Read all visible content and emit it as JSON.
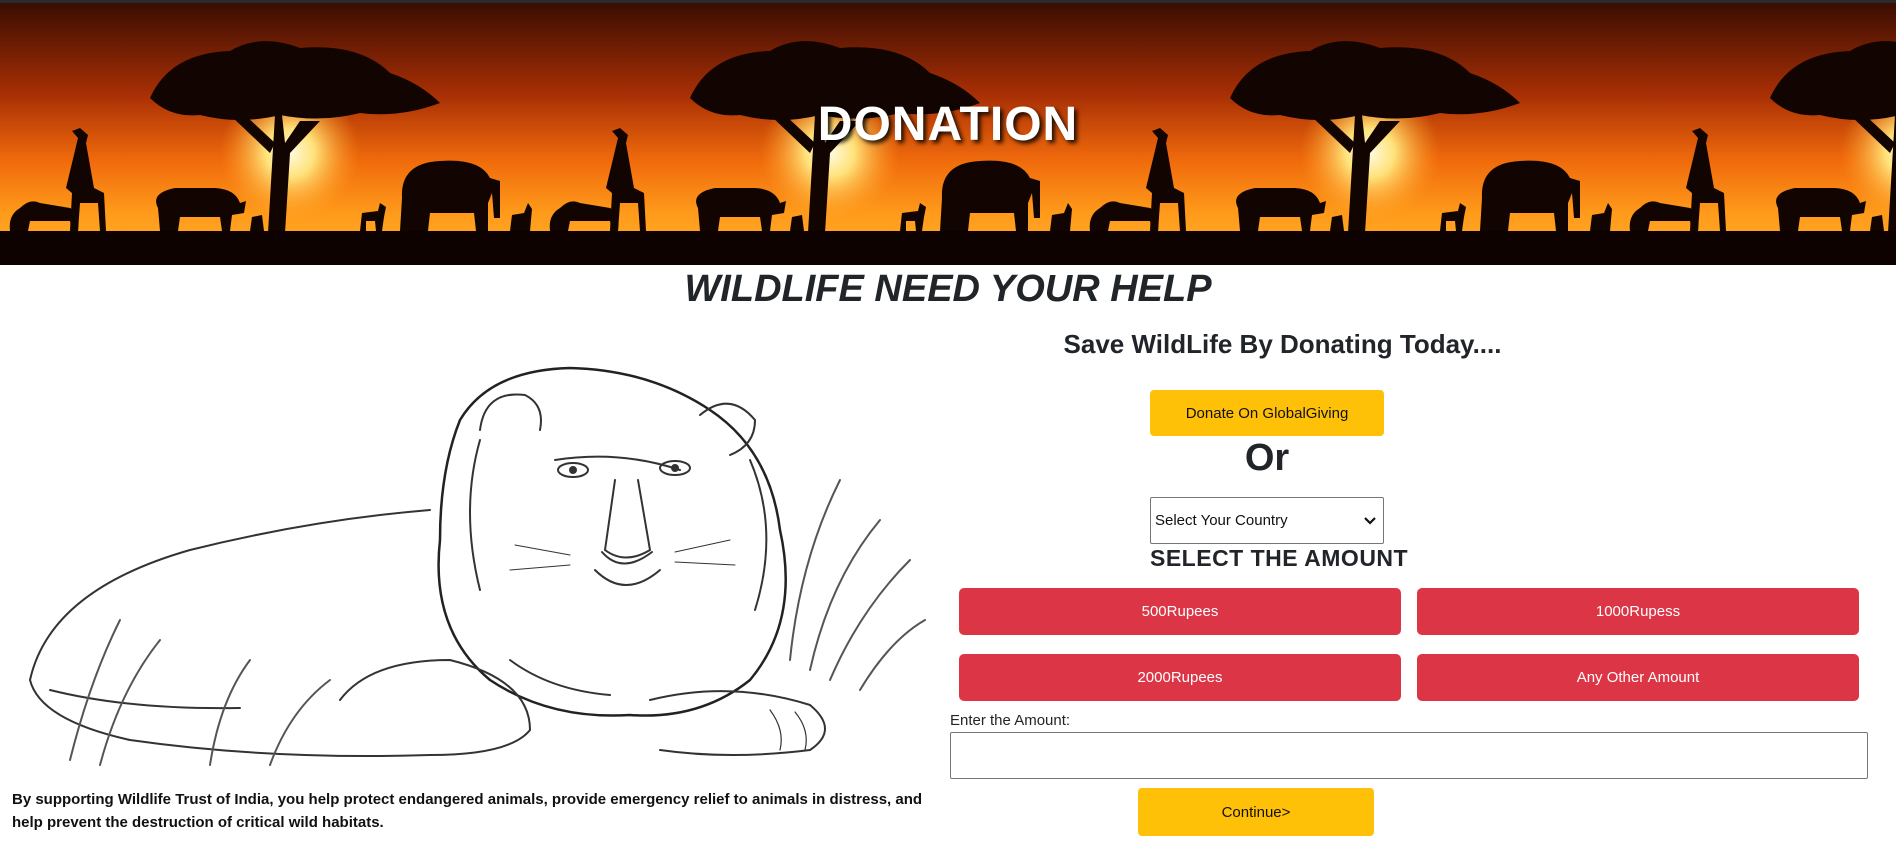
{
  "banner": {
    "title": "DONATION"
  },
  "headline": "WILDLIFE NEED YOUR HELP",
  "intro": {
    "text": "By supporting Wildlife Trust of India, you help protect endangered animals, provide emergency relief to animals in distress, and help prevent the destruction of critical wild habitats."
  },
  "donate": {
    "heading": "Save WildLife By Donating Today....",
    "globalgiving_label": "Donate On GlobalGiving",
    "or_text": "Or",
    "country_select": {
      "selected": "Select Your Country"
    },
    "amount_heading": "SELECT THE AMOUNT",
    "amounts": [
      "500Rupees",
      "1000Rupess",
      "2000Rupees",
      "Any Other Amount"
    ],
    "amount_field_label": "Enter the Amount:",
    "amount_field_value": "",
    "continue_label": "Continue>"
  },
  "colors": {
    "accent_yellow": "#ffc107",
    "accent_red": "#dc3545",
    "text_dark": "#212529"
  }
}
